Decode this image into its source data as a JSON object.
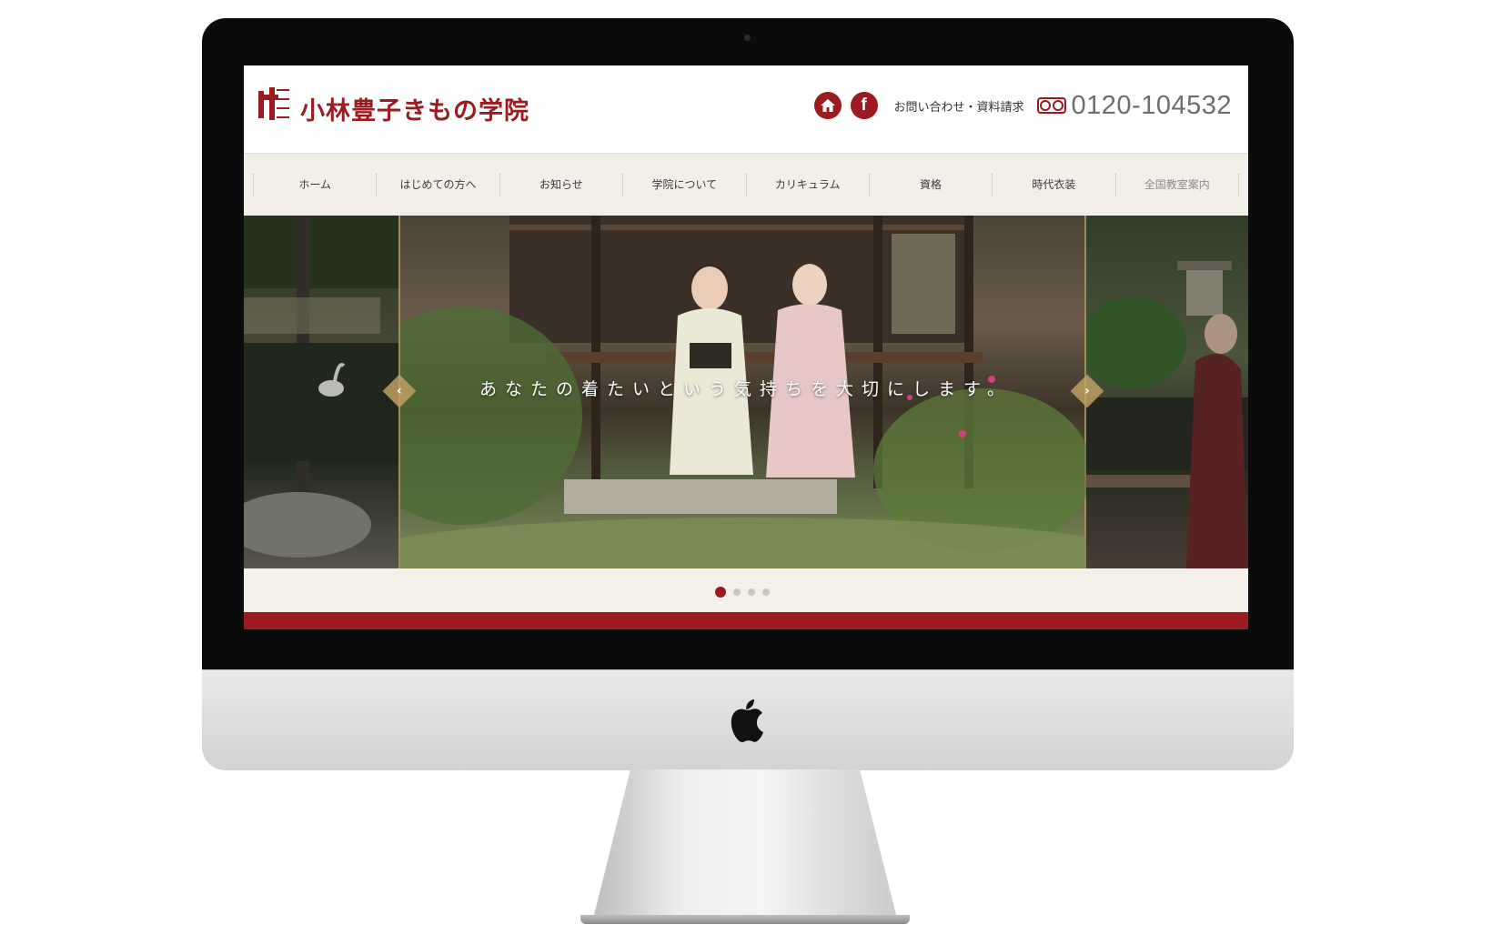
{
  "site": {
    "logo_text": "小林豊子きもの学院",
    "contact_link": "お問い合わせ・資料請求",
    "phone": "0120-104532",
    "facebook_glyph": "f",
    "brand_color": "#9b1b20"
  },
  "nav": {
    "items": [
      {
        "label": "ホーム"
      },
      {
        "label": "はじめての方へ"
      },
      {
        "label": "お知らせ"
      },
      {
        "label": "学院について"
      },
      {
        "label": "カリキュラム"
      },
      {
        "label": "資格"
      },
      {
        "label": "時代衣装"
      },
      {
        "label": "全国教室案内"
      }
    ]
  },
  "hero": {
    "tagline": "あなたの着たいという気持ちを大切にします。",
    "prev_glyph": "‹",
    "next_glyph": "›",
    "slide_count": 4,
    "active_slide": 1
  },
  "icons": [
    "home-icon",
    "facebook-icon",
    "freedial-icon",
    "apple-logo-icon"
  ]
}
